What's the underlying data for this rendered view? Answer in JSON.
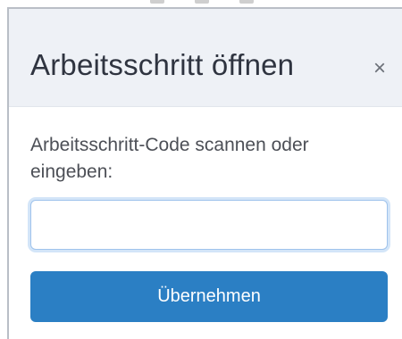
{
  "dialog": {
    "title": "Arbeitsschritt öffnen",
    "close_label": "×",
    "field": {
      "label": "Arbeitsschritt-Code scannen oder eingeben:",
      "value": "",
      "placeholder": ""
    },
    "submit_label": "Übernehmen"
  },
  "colors": {
    "header_bg": "#eef1f6",
    "accent": "#2b7fc4",
    "input_focus_border": "#9fc3ec"
  },
  "icons": {
    "close": "close-icon"
  }
}
